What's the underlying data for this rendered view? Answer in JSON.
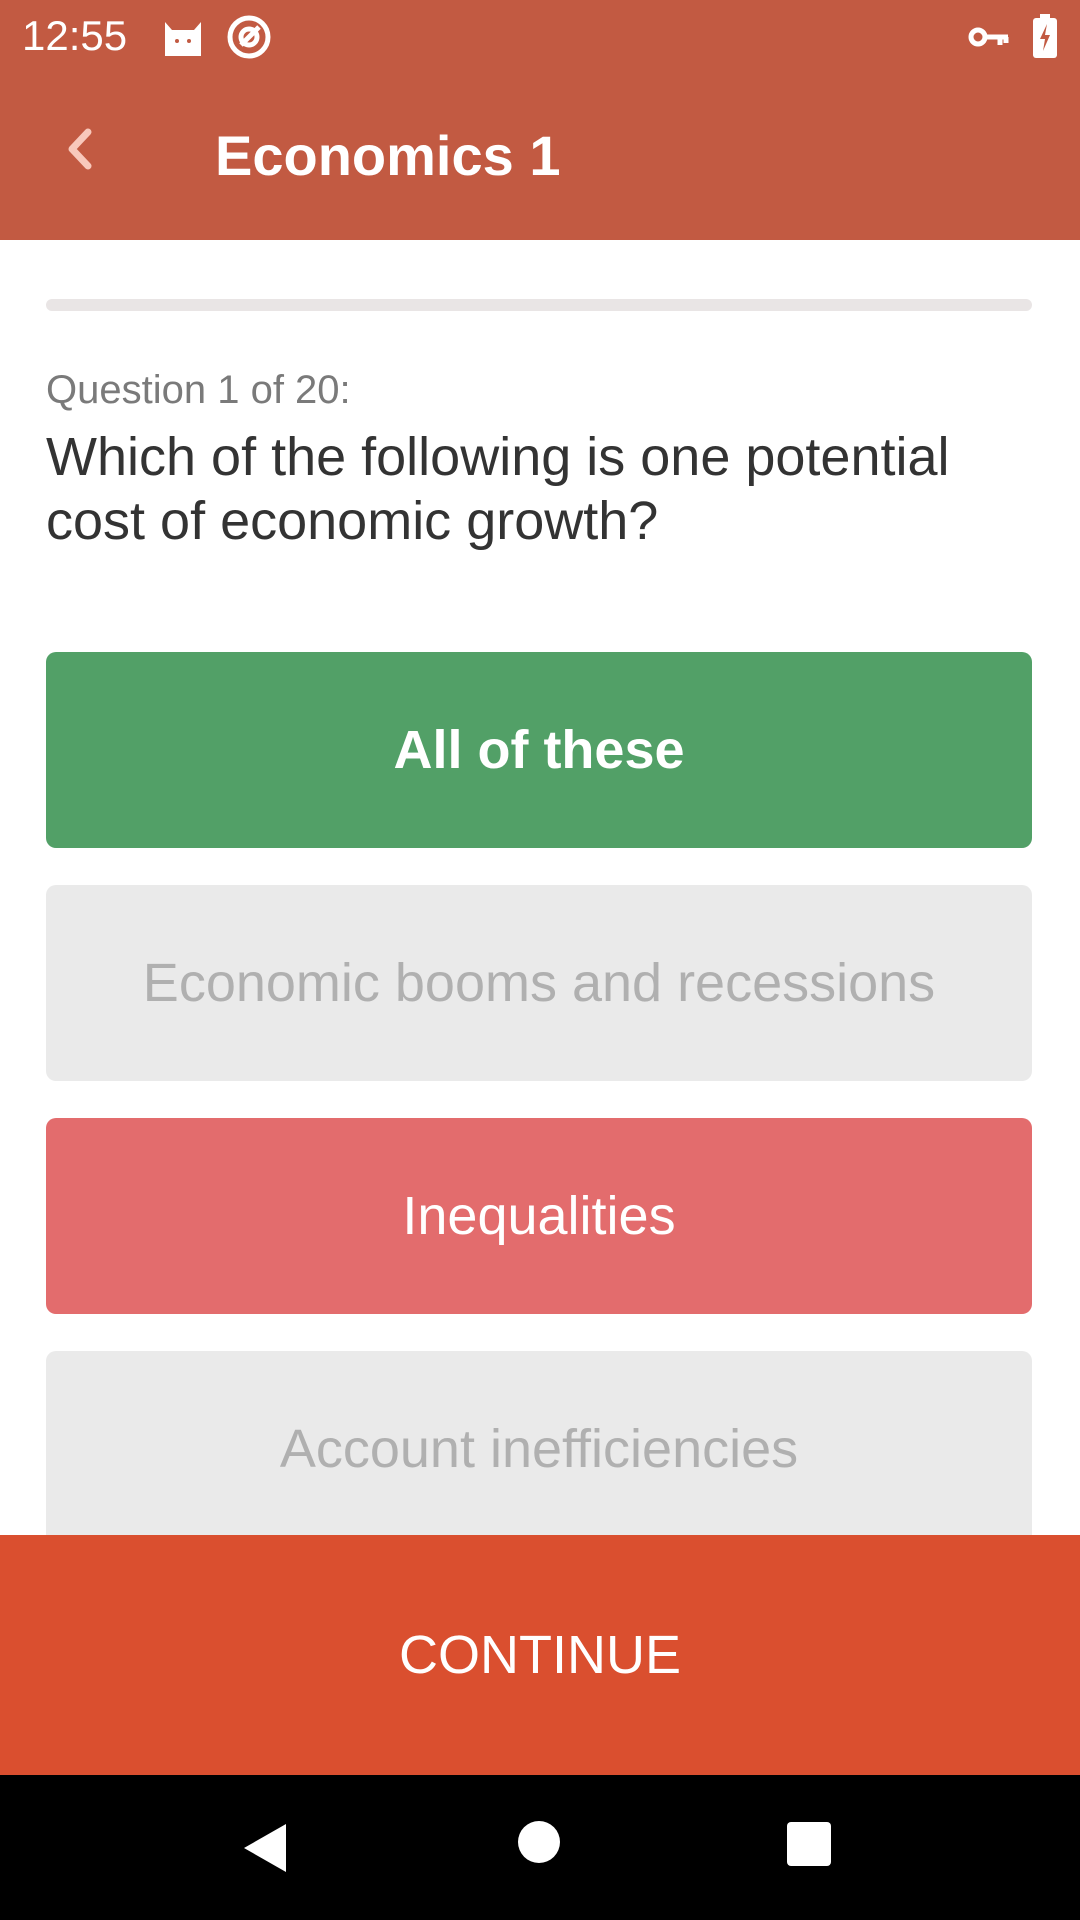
{
  "status_bar": {
    "time": "12:55",
    "icons": [
      "cat-notification-icon",
      "at-sign-icon",
      "vpn-key-icon",
      "battery-charging-icon"
    ]
  },
  "app_bar": {
    "title": "Economics 1",
    "back_icon": "chevron-left-icon"
  },
  "quiz": {
    "progress_fraction": 0,
    "counter": "Question 1 of 20:",
    "question": "Which of the following is one potential cost of economic growth?",
    "options": [
      {
        "label": "All of these",
        "state": "correct"
      },
      {
        "label": "Economic booms and recessions",
        "state": "neutral"
      },
      {
        "label": "Inequalities",
        "state": "wrong"
      },
      {
        "label": "Account inefficiencies",
        "state": "neutral"
      }
    ]
  },
  "continue_label": "CONTINUE",
  "nav": {
    "icons": [
      "back-triangle-icon",
      "home-circle-icon",
      "recents-square-icon"
    ]
  },
  "colors": {
    "app_bar": "#c25a42",
    "correct": "#52a067",
    "wrong": "#e36c6d",
    "neutral": "#eaeaea",
    "continue": "#da4f2f"
  }
}
